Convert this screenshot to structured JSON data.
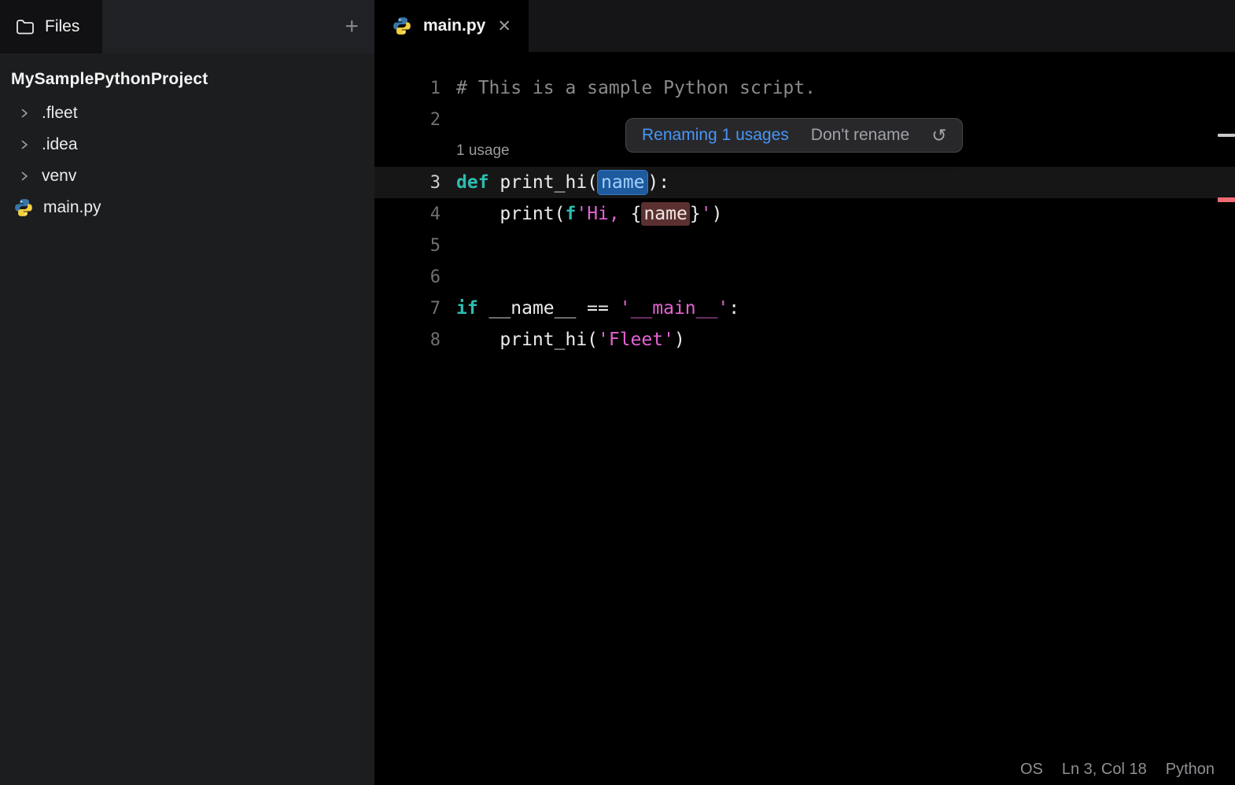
{
  "sidebar": {
    "files_tab": {
      "label": "Files"
    },
    "add_button_label": "+",
    "project_name": "MySamplePythonProject",
    "tree_items": [
      {
        "label": ".fleet",
        "kind": "folder"
      },
      {
        "label": ".idea",
        "kind": "folder"
      },
      {
        "label": "venv",
        "kind": "folder"
      },
      {
        "label": "main.py",
        "kind": "python"
      }
    ]
  },
  "editor": {
    "tabs": [
      {
        "label": "main.py",
        "close_icon": "✕",
        "active": true
      }
    ],
    "rename_popup": {
      "primary_label": "Renaming 1 usages",
      "secondary_label": "Don't rename",
      "reset_icon": "↺"
    },
    "lines": [
      {
        "num": "1",
        "tokens": [
          {
            "t": "# This is a sample Python script.",
            "c": "comment"
          }
        ]
      },
      {
        "num": "2",
        "tokens": []
      },
      {
        "inlay": "1 usage"
      },
      {
        "num": "3",
        "current": true,
        "tokens": [
          {
            "t": "def",
            "c": "kw"
          },
          {
            "t": " print_hi(",
            "c": "plain"
          },
          {
            "t": "name",
            "c": "rename"
          },
          {
            "t": "):",
            "c": "plain"
          }
        ]
      },
      {
        "num": "4",
        "tokens": [
          {
            "t": "    print(",
            "c": "plain"
          },
          {
            "t": "f",
            "c": "kw"
          },
          {
            "t": "'Hi, ",
            "c": "str"
          },
          {
            "t": "{",
            "c": "plain"
          },
          {
            "t": "name",
            "c": "usage"
          },
          {
            "t": "}",
            "c": "plain"
          },
          {
            "t": "'",
            "c": "str"
          },
          {
            "t": ")",
            "c": "plain"
          }
        ]
      },
      {
        "num": "5",
        "tokens": []
      },
      {
        "num": "6",
        "tokens": []
      },
      {
        "num": "7",
        "tokens": [
          {
            "t": "if",
            "c": "kw"
          },
          {
            "t": " __name__ == ",
            "c": "plain"
          },
          {
            "t": "'__main__'",
            "c": "str"
          },
          {
            "t": ":",
            "c": "plain"
          }
        ]
      },
      {
        "num": "8",
        "tokens": [
          {
            "t": "    print_hi(",
            "c": "plain"
          },
          {
            "t": "'Fleet'",
            "c": "str"
          },
          {
            "t": ")",
            "c": "plain"
          }
        ]
      }
    ],
    "status_bar": {
      "os": "OS",
      "cursor": "Ln 3, Col 18",
      "language": "Python"
    }
  },
  "colors": {
    "accent-blue": "#4896f5",
    "keyword": "#2dbdb0",
    "string": "#e363d4",
    "comment": "#8a8a8a",
    "plain": "#ececec",
    "rename-bg": "#1d5a9e",
    "rename-text": "#a3d0ff",
    "usage-bg": "#5a3130",
    "stripe-light": "#c9c9c9",
    "stripe-red": "#ef6b74"
  }
}
